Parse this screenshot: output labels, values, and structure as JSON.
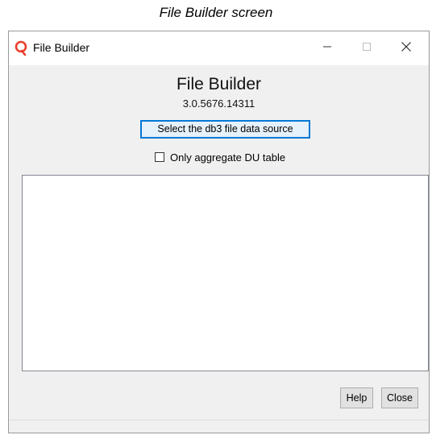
{
  "caption": "File Builder screen",
  "window": {
    "title": "File Builder",
    "app_icon": "qlik-q-icon",
    "controls": {
      "minimize": "minimize-icon",
      "maximize": "maximize-icon",
      "close": "close-icon"
    }
  },
  "main": {
    "heading": "File Builder",
    "version": "3.0.5676.14311",
    "select_button_label": "Select the db3 file data source",
    "checkbox_label": "Only aggregate DU table",
    "checkbox_checked": false,
    "log_text": ""
  },
  "footer": {
    "help_label": "Help",
    "close_label": "Close"
  },
  "colors": {
    "accent": "#0078d7",
    "app_icon": "#e8402c",
    "window_bg": "#f0f0f0"
  }
}
